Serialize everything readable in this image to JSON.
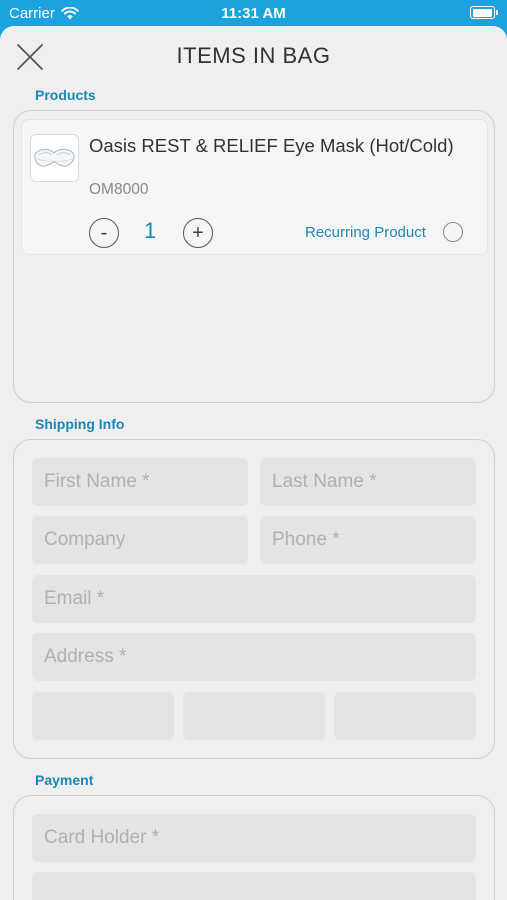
{
  "status_bar": {
    "carrier": "Carrier",
    "time": "11:31 AM",
    "battery_level": 1.0
  },
  "header": {
    "title": "ITEMS IN BAG",
    "close_icon": "close-icon"
  },
  "products": {
    "label": "Products",
    "items": [
      {
        "name": "Oasis REST & RELIEF Eye Mask (Hot/Cold)",
        "sku": "OM8000",
        "quantity": "1",
        "decrement": "-",
        "increment": "+",
        "recurring_label": "Recurring Product",
        "recurring_checked": false
      }
    ]
  },
  "shipping": {
    "label": "Shipping Info",
    "first_name": {
      "placeholder": "First Name *",
      "value": ""
    },
    "last_name": {
      "placeholder": "Last Name *",
      "value": ""
    },
    "company": {
      "placeholder": "Company",
      "value": ""
    },
    "phone": {
      "placeholder": "Phone *",
      "value": ""
    },
    "email": {
      "placeholder": "Email *",
      "value": ""
    },
    "address": {
      "placeholder": "Address *",
      "value": ""
    },
    "city": {
      "placeholder": "",
      "value": ""
    },
    "state": {
      "placeholder": "",
      "value": ""
    },
    "zip": {
      "placeholder": "",
      "value": ""
    }
  },
  "payment": {
    "label": "Payment",
    "card_holder": {
      "placeholder": "Card Holder *",
      "value": ""
    },
    "card_number": {
      "placeholder": "",
      "value": ""
    }
  },
  "colors": {
    "accent": "#1b87b5",
    "status_bar_bg": "#1aa3dc",
    "sheet_bg": "#efefef",
    "field_bg": "#e4e4e4"
  }
}
